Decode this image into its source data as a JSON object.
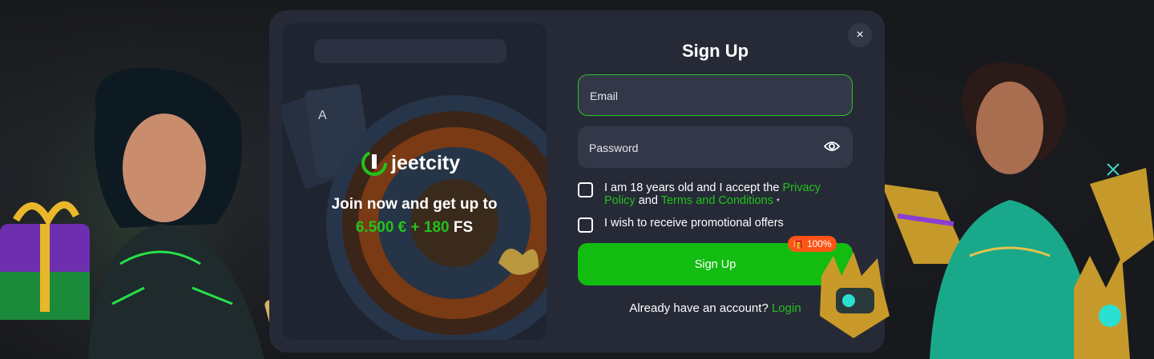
{
  "promo": {
    "brand": "jeetcity",
    "headline": "Join now and get up to",
    "amount": "6.500 € + 180",
    "amount_suffix": "FS"
  },
  "form": {
    "close_label": "×",
    "title": "Sign Up",
    "email_placeholder": "Email",
    "password_placeholder": "Password",
    "terms_text_1": "I am 18 years old and I accept the",
    "privacy_link": "Privacy Policy",
    "terms_and": "and",
    "terms_link": "Terms and Conditions",
    "terms_required": "*",
    "promo_opt_in": "I wish to receive promotional offers",
    "signup_button": "Sign Up",
    "badge_text": "100%",
    "already_text": "Already have an account?",
    "login_link": "Login"
  },
  "colors": {
    "accent": "#12bc10",
    "link": "#23c21d",
    "badge": "#ff5315",
    "modal_bg": "#262a37",
    "field_bg": "#333849"
  }
}
